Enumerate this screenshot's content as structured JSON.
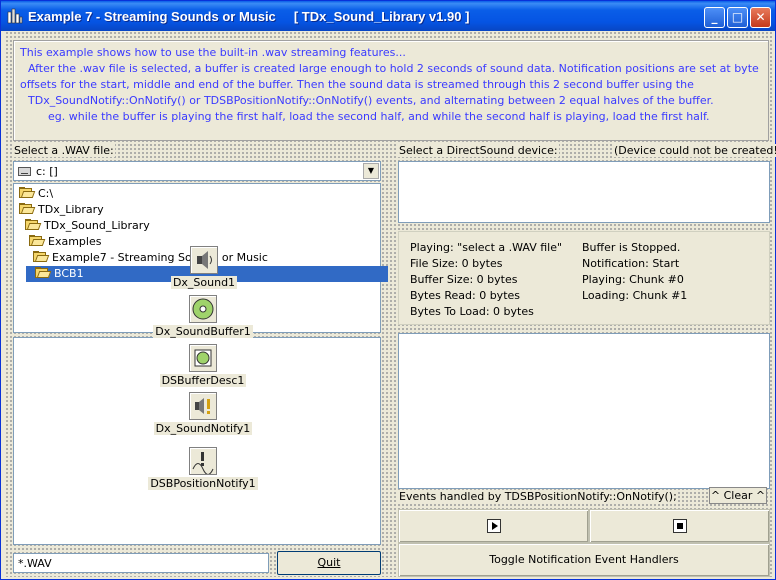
{
  "window": {
    "title": "Example 7 - Streaming Sounds or Music",
    "library": "[ TDx_Sound_Library v1.90 ]"
  },
  "info": {
    "lines": [
      "This example shows how to use the built-in .wav streaming features...",
      "After the .wav file is selected, a buffer is created large enough to hold 2 seconds of sound data. Notification positions are set at byte",
      "offsets for the start, middle and end of the buffer. Then the sound data is streamed through this 2 second buffer using the",
      "TDx_SoundNotify::OnNotify() or TDSBPositionNotify::OnNotify() events, and alternating between 2 equal halves of the buffer.",
      "eg. while the buffer is playing the first half, load the second half, and while the second half is playing, load the first half."
    ]
  },
  "left": {
    "select_label": "Select a .WAV file:",
    "drive": "c: []",
    "tree": [
      "C:\\",
      "TDx_Library",
      "TDx_Sound_Library",
      "Examples",
      "Example7 - Streaming Sounds or Music",
      "BCB1"
    ],
    "mask": "*.WAV",
    "quit": "Quit"
  },
  "right": {
    "device_label": "Select a DirectSound device:",
    "device_error": "(Device could not be created!)",
    "status_left": [
      "Playing: \"select a .WAV file\"",
      "File Size: 0 bytes",
      "Buffer Size: 0 bytes",
      "Bytes Read: 0 bytes",
      "Bytes To Load: 0 bytes"
    ],
    "status_right": [
      "Buffer is Stopped.",
      "Notification: Start",
      "Playing: Chunk #0",
      "Loading: Chunk #1"
    ],
    "events_label": "Events handled by TDSBPositionNotify::OnNotify();",
    "clear": "^ Clear ^",
    "toggle": "Toggle Notification Event Handlers"
  },
  "components": [
    "Dx_Sound1",
    "Dx_SoundBuffer1",
    "DSBufferDesc1",
    "Dx_SoundNotify1",
    "DSBPositionNotify1"
  ],
  "colors": {
    "title_bar": "#0a5ee8",
    "info_text": "#3a3aff",
    "selection": "#316ac5"
  }
}
